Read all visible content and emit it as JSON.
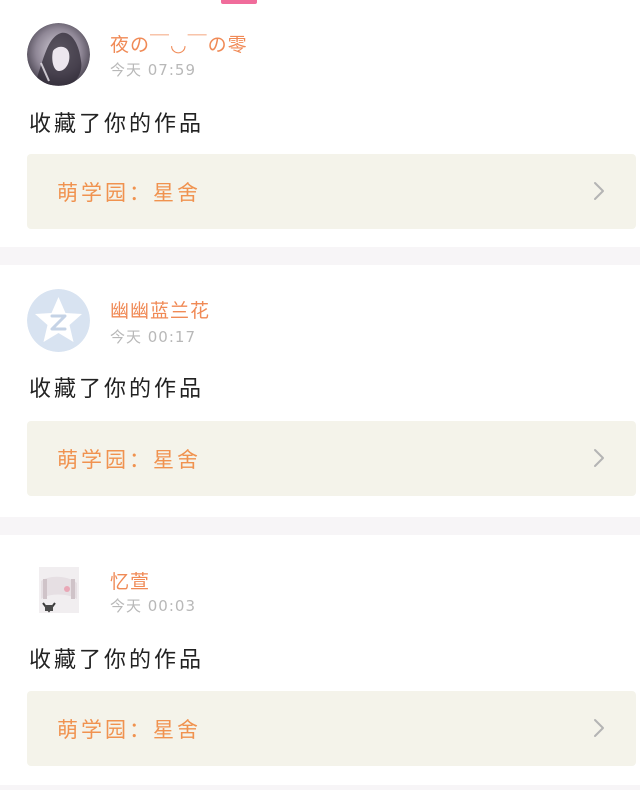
{
  "feed": {
    "items": [
      {
        "user": {
          "name": "夜の￣◡￣の零",
          "avatar_icon": "profile-photo-icon"
        },
        "time": "今天 07:59",
        "action": "收藏了你的作品",
        "source_label": "萌学园：星舍"
      },
      {
        "user": {
          "name": "幽幽蓝兰花",
          "avatar_icon": "qzone-default-avatar-icon"
        },
        "time": "今天 00:17",
        "action": "收藏了你的作品",
        "source_label": "萌学园：星舍"
      },
      {
        "user": {
          "name": "忆萱",
          "avatar_icon": "profile-photo-icon"
        },
        "time": "今天 00:03",
        "action": "收藏了你的作品",
        "source_label": "萌学园：星舍"
      }
    ]
  },
  "colors": {
    "username": "#f08a56",
    "source_text": "#f0924f",
    "source_bg": "#f4f3ea",
    "timestamp": "#b8b8b8",
    "tab_indicator": "#f06c9b",
    "divider_bg": "#f7f5f7"
  }
}
